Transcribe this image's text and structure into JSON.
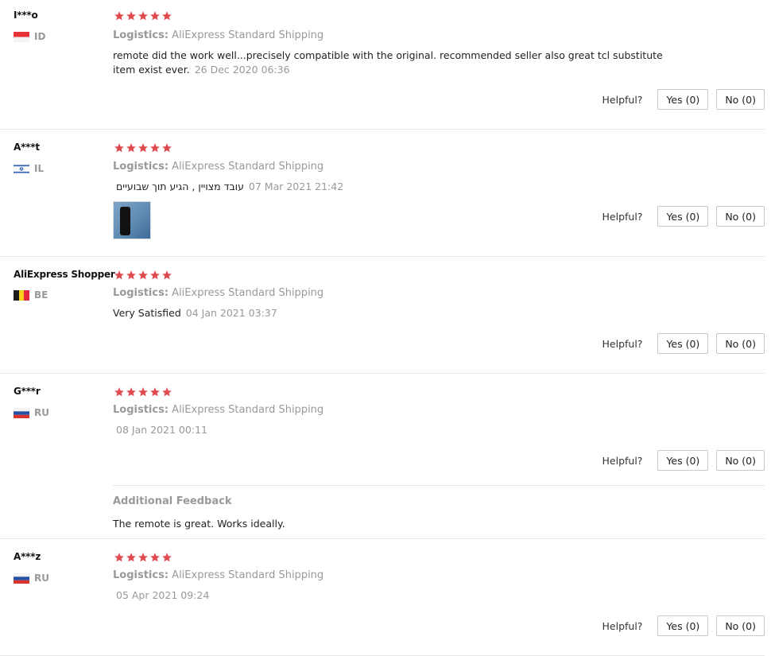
{
  "helpful_label": "Helpful?",
  "colors": {
    "star": "#e04a4f",
    "muted": "#999999"
  },
  "reviews": [
    {
      "name": "I***o",
      "country": "ID",
      "flag": "indonesia",
      "stars": 5,
      "logistics_label": "Logistics:",
      "logistics": "AliExpress Standard Shipping",
      "text": "remote did the work well...precisely compatible with the original. recommended seller also great tcl substitute item exist ever.",
      "date": "26 Dec 2020 06:36",
      "yes": "Yes (0)",
      "no": "No (0)"
    },
    {
      "name": "A***t",
      "country": "IL",
      "flag": "israel",
      "stars": 5,
      "logistics_label": "Logistics:",
      "logistics": "AliExpress Standard Shipping",
      "text": "עובד מצויין , הגיע תוך שבועיים",
      "date": "07 Mar 2021 21:42",
      "has_photo": true,
      "yes": "Yes (0)",
      "no": "No (0)"
    },
    {
      "name": "AliExpress Shopper",
      "country": "BE",
      "flag": "belgium",
      "stars": 5,
      "logistics_label": "Logistics:",
      "logistics": "AliExpress Standard Shipping",
      "text": "Very Satisfied",
      "date": "04 Jan 2021 03:37",
      "yes": "Yes (0)",
      "no": "No (0)"
    },
    {
      "name": "G***r",
      "country": "RU",
      "flag": "russia",
      "stars": 5,
      "logistics_label": "Logistics:",
      "logistics": "AliExpress Standard Shipping",
      "text": "",
      "date": "08 Jan 2021 00:11",
      "yes": "Yes (0)",
      "no": "No (0)",
      "additional_title": "Additional Feedback",
      "additional_text": "The remote is great. Works ideally."
    },
    {
      "name": "A***z",
      "country": "RU",
      "flag": "russia",
      "stars": 5,
      "logistics_label": "Logistics:",
      "logistics": "AliExpress Standard Shipping",
      "text": "",
      "date": "05 Apr 2021 09:24",
      "yes": "Yes (0)",
      "no": "No (0)"
    }
  ]
}
